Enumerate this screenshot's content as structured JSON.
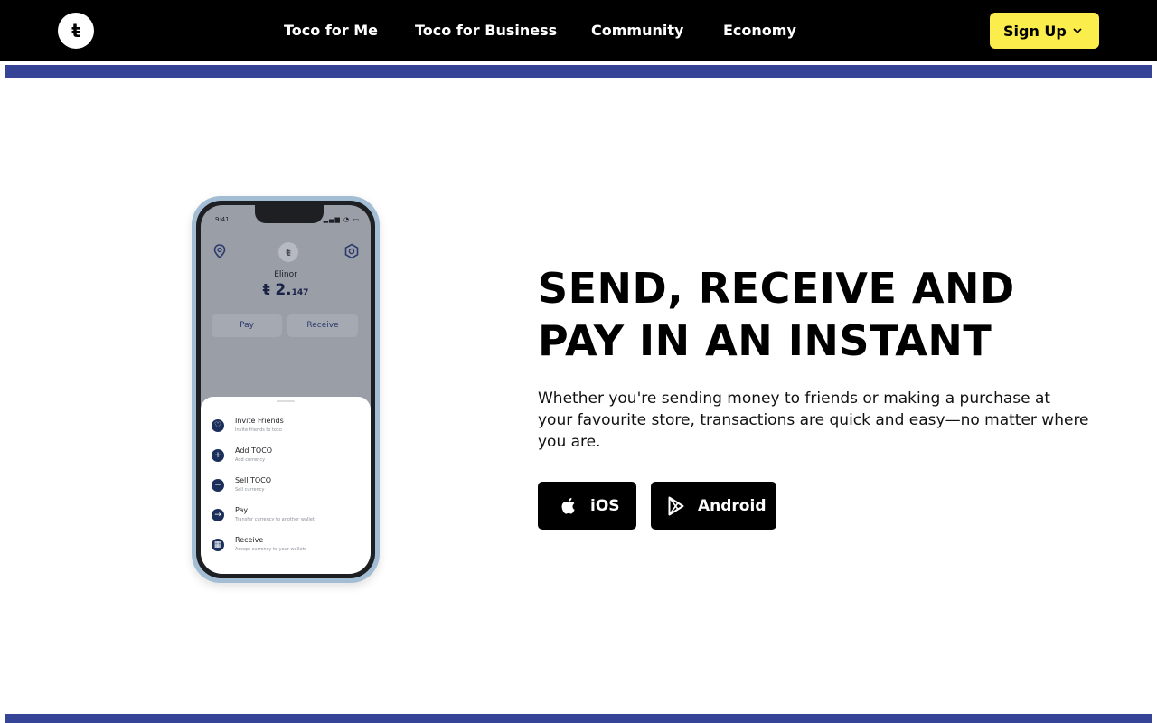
{
  "nav": {
    "logo_glyph": "ŧ",
    "links": [
      "Toco for Me",
      "Toco for Business",
      "Community",
      "Economy"
    ],
    "signup_label": "Sign Up"
  },
  "phone": {
    "time": "9:41",
    "user_name": "Elinor",
    "balance_symbol": "ŧ",
    "balance_whole": "2.",
    "balance_fraction": "147",
    "pay_label": "Pay",
    "receive_label": "Receive",
    "sheet_items": [
      {
        "title": "Invite Friends",
        "subtitle": "Invite friends to toco"
      },
      {
        "title": "Add TOCO",
        "subtitle": "Add currency"
      },
      {
        "title": "Sell TOCO",
        "subtitle": "Sell currency"
      },
      {
        "title": "Pay",
        "subtitle": "Transfer currency to another wallet"
      },
      {
        "title": "Receive",
        "subtitle": "Accept currency to your wallets"
      }
    ]
  },
  "hero": {
    "headline_line1": "SEND, RECEIVE AND",
    "headline_line2": "PAY IN AN INSTANT",
    "subtext": "Whether you're sending money to friends or making a purchase at your favourite store, transactions are quick and easy—no matter where you are.",
    "ios_label": "iOS",
    "android_label": "Android"
  },
  "colors": {
    "nav_bg": "#000000",
    "signup_bg": "#fbed4b",
    "band": "#354496"
  }
}
